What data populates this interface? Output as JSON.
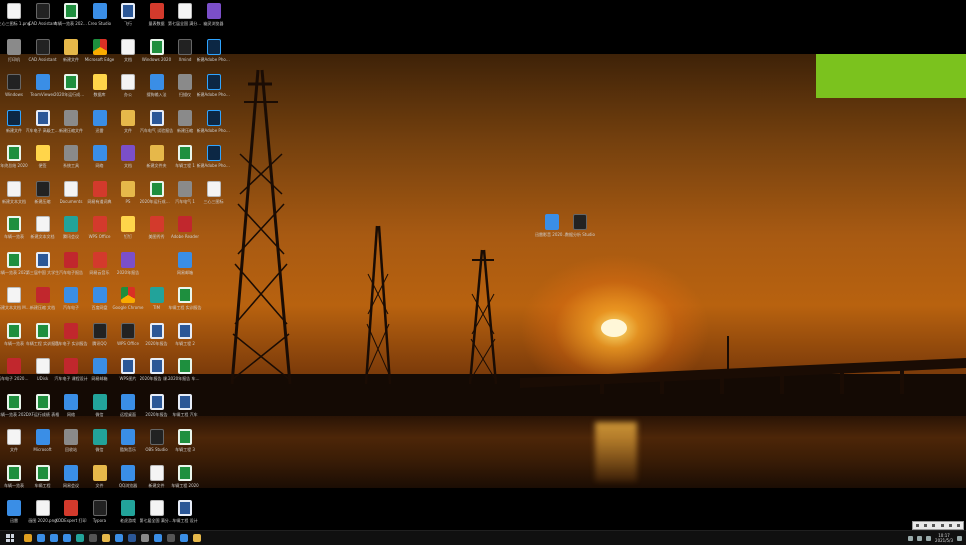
{
  "colors": {
    "desktop_black": "#000000",
    "banner_green": "#7bc21e",
    "sky_orange": "#b8620f",
    "sun": "#fff7d8"
  },
  "desktop_icons": [
    {
      "label": "三心三图标 1.png",
      "kind": "doc"
    },
    {
      "label": "CAD Assistant",
      "kind": "dark"
    },
    {
      "label": "车辆一览表 2020年5月",
      "kind": "excel"
    },
    {
      "label": "Creo Studio",
      "kind": "app"
    },
    {
      "label": "飞行",
      "kind": "word"
    },
    {
      "label": "量表数据",
      "kind": "red"
    },
    {
      "label": "第七届全国 满分中学 大赛",
      "kind": "doc"
    },
    {
      "label": "幽灵浏览器",
      "kind": "purple"
    },
    {
      "label": "打印机",
      "kind": "gray"
    },
    {
      "label": "CAD Assistant",
      "kind": "dark"
    },
    {
      "label": "新建文件",
      "kind": "folder"
    },
    {
      "label": "Microsoft Edge",
      "kind": "browser"
    },
    {
      "label": "文档",
      "kind": "doc"
    },
    {
      "label": "Windows 2020",
      "kind": "excel"
    },
    {
      "label": "Xmind",
      "kind": "dark"
    },
    {
      "label": "新建Adobe Photoshop",
      "kind": "ps"
    },
    {
      "label": "Windows",
      "kind": "dark"
    },
    {
      "label": "TeamViewer",
      "kind": "app"
    },
    {
      "label": "2020年运行成绩表",
      "kind": "excel"
    },
    {
      "label": "数据库",
      "kind": "yellow"
    },
    {
      "label": "办公",
      "kind": "doc"
    },
    {
      "label": "搜狗输入法",
      "kind": "app"
    },
    {
      "label": "扫描仪",
      "kind": "gray"
    },
    {
      "label": "新建Adobe Photoshop",
      "kind": "ps"
    },
    {
      "label": "新建文件",
      "kind": "ps"
    },
    {
      "label": "汽车电子 高级工程师",
      "kind": "word"
    },
    {
      "label": "新建压缩文件",
      "kind": "gray"
    },
    {
      "label": "迅雷",
      "kind": "app"
    },
    {
      "label": "文件",
      "kind": "folder"
    },
    {
      "label": "汽车电气 试验报告",
      "kind": "word"
    },
    {
      "label": "新建压缩",
      "kind": "gray"
    },
    {
      "label": "新建Adobe Photoshop",
      "kind": "ps"
    },
    {
      "label": "年终总结 2020",
      "kind": "excel"
    },
    {
      "label": "便签",
      "kind": "yellow"
    },
    {
      "label": "系统工具",
      "kind": "gray"
    },
    {
      "label": "网络",
      "kind": "app"
    },
    {
      "label": "文档",
      "kind": "purple"
    },
    {
      "label": "新建文件夹",
      "kind": "folder"
    },
    {
      "label": "车辆工程 1",
      "kind": "excel"
    },
    {
      "label": "新建Adobe Photoshop",
      "kind": "ps"
    },
    {
      "label": "新建文本文档",
      "kind": "doc"
    },
    {
      "label": "新建压缩",
      "kind": "dark"
    },
    {
      "label": "Documents",
      "kind": "doc"
    },
    {
      "label": "网易有道词典",
      "kind": "red"
    },
    {
      "label": "PS",
      "kind": "folder"
    },
    {
      "label": "2020年运行成绩表",
      "kind": "excel"
    },
    {
      "label": "汽车电气 1",
      "kind": "gray"
    },
    {
      "label": "三心三图标",
      "kind": "doc"
    },
    {
      "label": "车辆一览表",
      "kind": "excel"
    },
    {
      "label": "新建文本文档",
      "kind": "doc"
    },
    {
      "label": "腾讯会议",
      "kind": "teal"
    },
    {
      "label": "WPS Office",
      "kind": "red"
    },
    {
      "label": "钉钉",
      "kind": "yellow"
    },
    {
      "label": "美图秀秀",
      "kind": "red"
    },
    {
      "label": "Adobe Reader",
      "kind": "pdf"
    },
    {
      "label": "",
      "kind": "none"
    },
    {
      "label": "车辆一览表 2020年",
      "kind": "excel"
    },
    {
      "label": "第三届中国 大学生",
      "kind": "word"
    },
    {
      "label": "汽车电子报告",
      "kind": "pdf"
    },
    {
      "label": "网易云音乐",
      "kind": "red"
    },
    {
      "label": "2020年报告",
      "kind": "purple"
    },
    {
      "label": "",
      "kind": "none"
    },
    {
      "label": "网易邮箱",
      "kind": "app"
    },
    {
      "label": "",
      "kind": "none"
    },
    {
      "label": "新建文本文档 Music",
      "kind": "doc"
    },
    {
      "label": "新建压缩 文档",
      "kind": "pdf"
    },
    {
      "label": "汽车电子",
      "kind": "app"
    },
    {
      "label": "百度网盘",
      "kind": "app"
    },
    {
      "label": "Google Chrome",
      "kind": "browser"
    },
    {
      "label": "TIM",
      "kind": "teal"
    },
    {
      "label": "车辆工程 实训报告",
      "kind": "excel"
    },
    {
      "label": "",
      "kind": "none"
    },
    {
      "label": "车辆一览表",
      "kind": "excel"
    },
    {
      "label": "车辆工程 实训报告",
      "kind": "excel"
    },
    {
      "label": "汽车电子 实训报告",
      "kind": "pdf"
    },
    {
      "label": "腾讯QQ",
      "kind": "dark"
    },
    {
      "label": "WPS Office",
      "kind": "dark"
    },
    {
      "label": "2020年报告",
      "kind": "word"
    },
    {
      "label": "车辆工程 2",
      "kind": "word"
    },
    {
      "label": "",
      "kind": "none"
    },
    {
      "label": "汽车电子 2020年报告",
      "kind": "pdf"
    },
    {
      "label": "UDisk",
      "kind": "doc"
    },
    {
      "label": "汽车电子 课程设计",
      "kind": "pdf"
    },
    {
      "label": "网易邮箱",
      "kind": "app"
    },
    {
      "label": "WPS图片",
      "kind": "word"
    },
    {
      "label": "2020年报告 课程设计",
      "kind": "word"
    },
    {
      "label": "2020年报告 车辆工程",
      "kind": "excel"
    },
    {
      "label": "",
      "kind": "none"
    },
    {
      "label": "车辆一览表 2020年",
      "kind": "excel"
    },
    {
      "label": "DXF运行成绩 表格",
      "kind": "excel"
    },
    {
      "label": "网络",
      "kind": "app"
    },
    {
      "label": "微信",
      "kind": "teal"
    },
    {
      "label": "远程桌面",
      "kind": "app"
    },
    {
      "label": "2020年报告",
      "kind": "word"
    },
    {
      "label": "车辆工程 汽车",
      "kind": "word"
    },
    {
      "label": "",
      "kind": "none"
    },
    {
      "label": "文件",
      "kind": "doc"
    },
    {
      "label": "Microsoft",
      "kind": "app"
    },
    {
      "label": "回收站",
      "kind": "gray"
    },
    {
      "label": "微信",
      "kind": "teal"
    },
    {
      "label": "酷狗音乐",
      "kind": "app"
    },
    {
      "label": "OBS Studio",
      "kind": "dark"
    },
    {
      "label": "车辆工程 3",
      "kind": "excel"
    },
    {
      "label": "",
      "kind": "none"
    },
    {
      "label": "车辆一览表",
      "kind": "excel"
    },
    {
      "label": "车辆工程",
      "kind": "excel"
    },
    {
      "label": "网易会议",
      "kind": "app"
    },
    {
      "label": "文件",
      "kind": "folder"
    },
    {
      "label": "QQ浏览器",
      "kind": "app"
    },
    {
      "label": "新建文件",
      "kind": "doc"
    },
    {
      "label": "车辆工程 2020",
      "kind": "excel"
    },
    {
      "label": "",
      "kind": "none"
    },
    {
      "label": "迅雷",
      "kind": "app"
    },
    {
      "label": "画图 2020.png",
      "kind": "doc"
    },
    {
      "label": "KODExpert 打印",
      "kind": "red"
    },
    {
      "label": "Typora",
      "kind": "dark"
    },
    {
      "label": "老虎游戏",
      "kind": "teal"
    },
    {
      "label": "第七届全国 满分中学",
      "kind": "doc"
    },
    {
      "label": "车辆工程 设计",
      "kind": "word"
    },
    {
      "label": "",
      "kind": "none"
    }
  ],
  "right_icons": [
    {
      "label": "迅雷影音 2020年1月",
      "kind": "app"
    },
    {
      "label": "数据分析 Studio",
      "kind": "dark"
    }
  ],
  "taskbar": {
    "items": [
      "browser",
      "app",
      "app",
      "app",
      "teal",
      "dark",
      "folder",
      "app",
      "word",
      "gray",
      "app",
      "dark",
      "app",
      "folder"
    ],
    "time": "10:17",
    "date": "2021/5/3"
  }
}
